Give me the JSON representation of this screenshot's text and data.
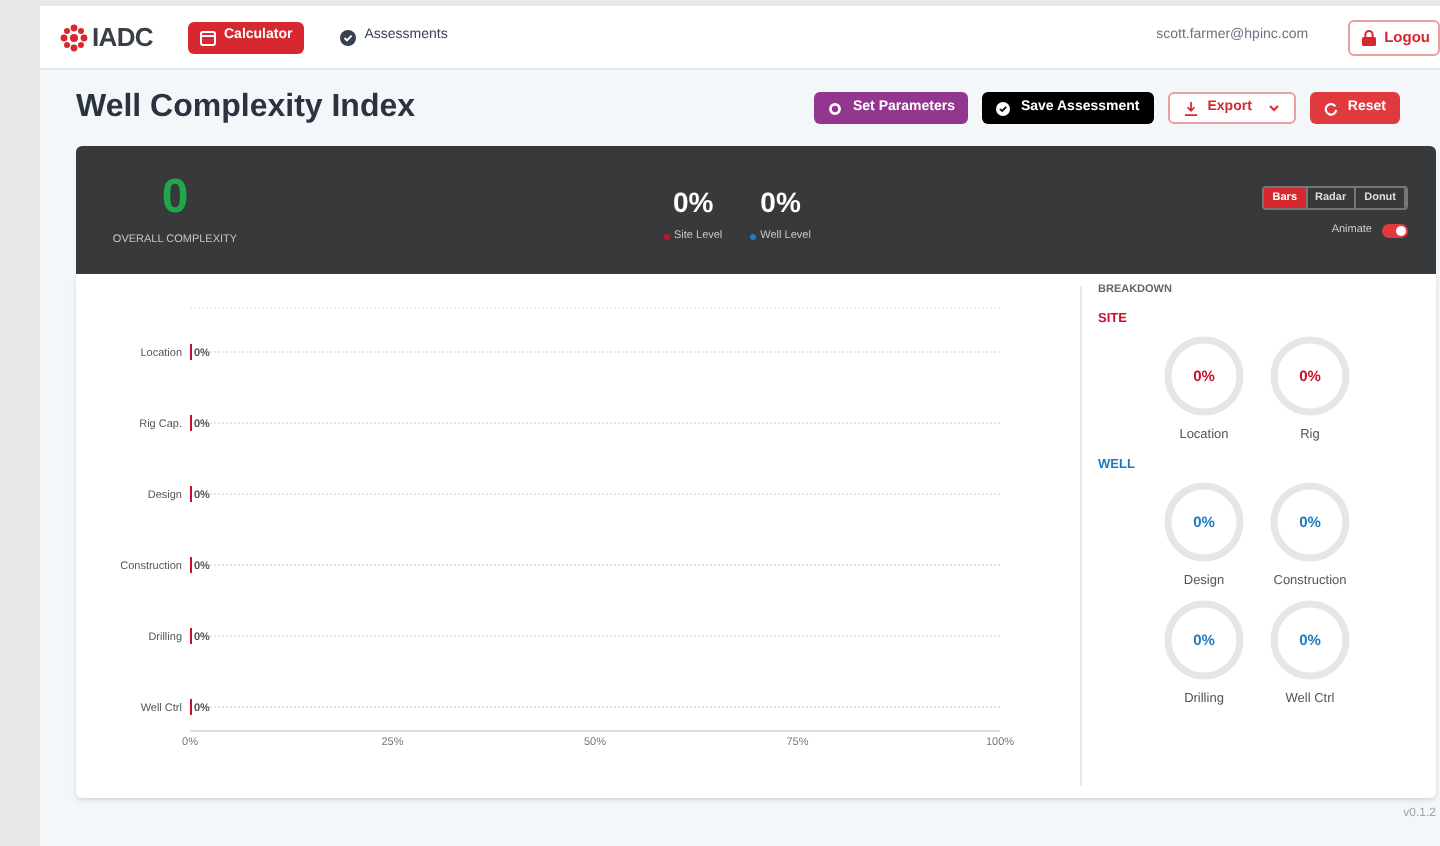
{
  "header": {
    "logo": "IADC",
    "nav": [
      {
        "label": "Calculator",
        "selected": true
      },
      {
        "label": "Assessments",
        "selected": false
      }
    ],
    "user_email": "scott.farmer@hpinc.com",
    "logout": "Logou"
  },
  "page_title": "Well Complexity Index",
  "actions": [
    {
      "kind": "params",
      "label": "Set Parameters"
    },
    {
      "kind": "save",
      "label": "Save Assessment"
    },
    {
      "kind": "export",
      "label": "Export"
    },
    {
      "kind": "reset",
      "label": "Reset"
    }
  ],
  "summary": {
    "overall_value": "0",
    "overall_label": "OVERALL COMPLEXITY",
    "levels": [
      {
        "value": "0%",
        "label": "Site Level",
        "color": "#c8102e"
      },
      {
        "value": "0%",
        "label": "Well Level",
        "color": "#1f7bbf"
      }
    ],
    "view_tabs": [
      {
        "label": "Bars",
        "selected": true
      },
      {
        "label": "Radar",
        "selected": false
      },
      {
        "label": "Donut",
        "selected": false
      }
    ],
    "animate_label": "Animate",
    "animate_on": true
  },
  "chart_data": {
    "type": "bar",
    "orientation": "horizontal",
    "categories": [
      "Location",
      "Rig Cap.",
      "Design",
      "Construction",
      "Drilling",
      "Well Ctrl"
    ],
    "values": [
      0,
      0,
      0,
      0,
      0,
      0
    ],
    "xlim": [
      0,
      100
    ],
    "xticks": [
      {
        "value": 0,
        "label": "0%"
      },
      {
        "value": 25,
        "label": "25%"
      },
      {
        "value": 50,
        "label": "50%"
      },
      {
        "value": 75,
        "label": "75%"
      },
      {
        "value": 100,
        "label": "100%"
      }
    ],
    "value_labels": [
      "0%",
      "0%",
      "0%",
      "0%",
      "0%",
      "0%"
    ]
  },
  "breakdown": {
    "title": "BREAKDOWN",
    "groups": [
      {
        "kind": "site",
        "title": "SITE",
        "items": [
          {
            "value": "0%",
            "label": "Location",
            "level": 0
          },
          {
            "value": "0%",
            "label": "Rig",
            "level": 0
          }
        ]
      },
      {
        "kind": "well",
        "title": "WELL",
        "items": [
          {
            "value": "0%",
            "label": "Design",
            "level": 0
          },
          {
            "value": "0%",
            "label": "Construction",
            "level": 0
          },
          {
            "value": "0%",
            "label": "Drilling",
            "level": 0
          },
          {
            "value": "0%",
            "label": "Well Ctrl",
            "level": 0
          }
        ]
      }
    ]
  },
  "version": "v0.1.2"
}
